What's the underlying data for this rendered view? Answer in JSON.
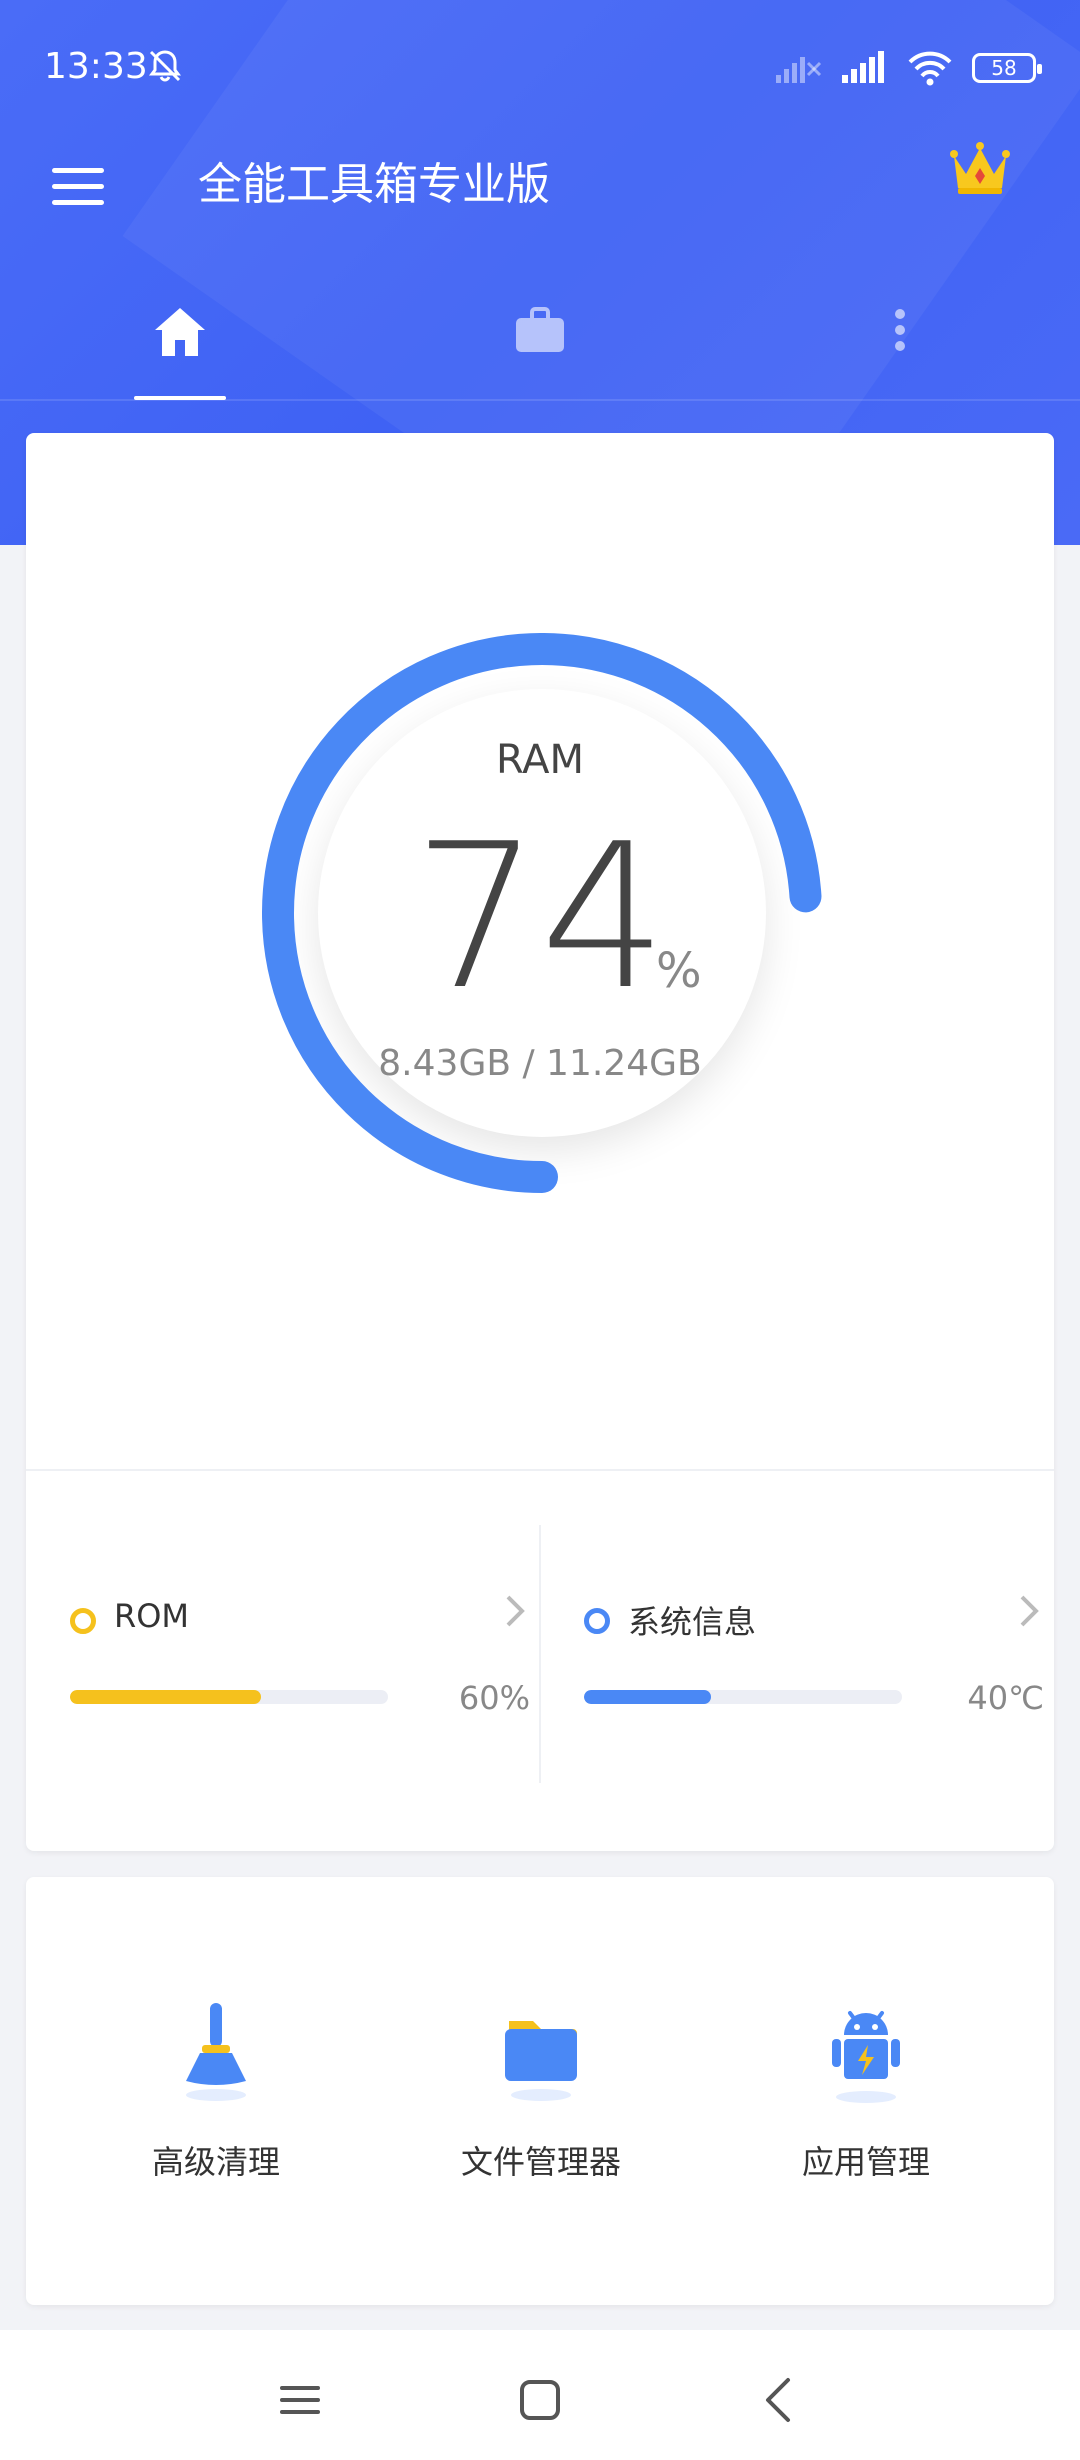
{
  "status_bar": {
    "time": "13:33",
    "battery": "58"
  },
  "toolbar": {
    "title": "全能工具箱专业版"
  },
  "tabs": [
    {
      "name": "home",
      "icon": "home-icon",
      "selected": true
    },
    {
      "name": "tools",
      "icon": "briefcase-icon",
      "selected": false
    },
    {
      "name": "more",
      "icon": "more-vertical-icon",
      "selected": false
    }
  ],
  "ram": {
    "label": "RAM",
    "percent_value": "74",
    "percent_sign": "%",
    "usage": "8.43GB / 11.24GB",
    "fraction": 0.74
  },
  "stats": {
    "rom": {
      "title": "ROM",
      "value": "60%",
      "fraction": 0.6
    },
    "system": {
      "title": "系统信息",
      "value": "40℃",
      "fraction": 0.4
    }
  },
  "tools": [
    {
      "label": "高级清理",
      "icon": "broom-icon"
    },
    {
      "label": "文件管理器",
      "icon": "folder-icon"
    },
    {
      "label": "应用管理",
      "icon": "android-icon"
    }
  ],
  "colors": {
    "primary": "#3f62f4",
    "accent_blue": "#4a88f5",
    "accent_yellow": "#f5c11d"
  }
}
